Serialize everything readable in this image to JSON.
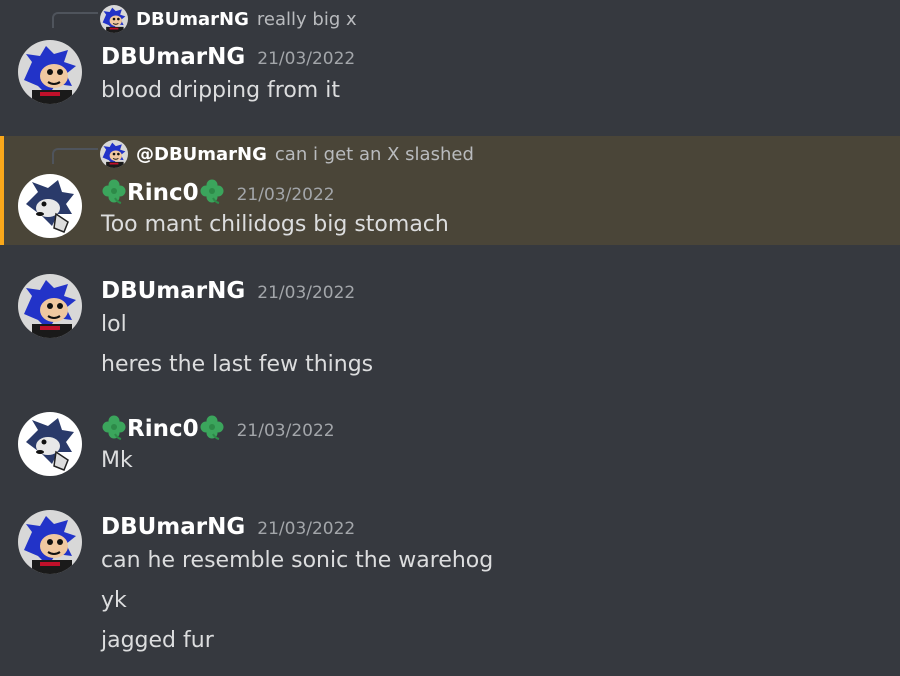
{
  "messages": [
    {
      "reply": {
        "author": "DBUmarNG",
        "text": "really big x"
      },
      "author": "DBUmarNG",
      "time": "21/03/2022",
      "lines": [
        "blood dripping from it"
      ]
    },
    {
      "reply": {
        "author": "@DBUmarNG",
        "text": "can i get an X slashed"
      },
      "author": "Rinc0",
      "time": "21/03/2022",
      "lines": [
        "Too mant chilidogs big stomach"
      ],
      "highlighted": true
    },
    {
      "author": "DBUmarNG",
      "time": "21/03/2022",
      "lines": [
        "lol",
        "heres the last few things"
      ]
    },
    {
      "author": "Rinc0",
      "time": "21/03/2022",
      "lines": [
        "Mk"
      ]
    },
    {
      "author": "DBUmarNG",
      "time": "21/03/2022",
      "lines": [
        "can he resemble sonic the warehog",
        "yk",
        "jagged fur"
      ]
    }
  ],
  "colors": {
    "background": "#36393f",
    "mention_highlight": "#4a4538",
    "mention_bar": "#faa81a",
    "clover": "#3ba55c"
  }
}
